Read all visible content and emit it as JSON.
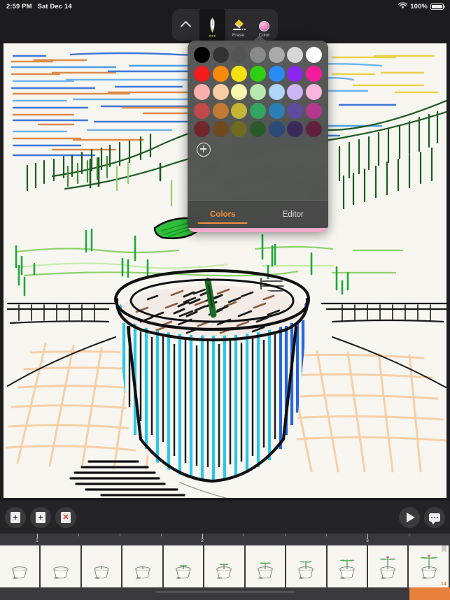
{
  "status_bar": {
    "time": "2:59 PM",
    "date": "Sat Dec 14",
    "battery_percent": "100%",
    "wifi_icon": "wifi-icon",
    "battery_icon": "battery-full-icon"
  },
  "toolbar": {
    "collapse_icon": "chevron-up-icon",
    "tools": [
      {
        "name": "pen",
        "label": "",
        "icon": "pen-nib-icon",
        "selected": true,
        "dots": "•••"
      },
      {
        "name": "erase",
        "label": "Erase",
        "icon": "eraser-icon",
        "selected": false
      },
      {
        "name": "color",
        "label": "Color",
        "icon": "color-swatch-icon",
        "selected": false
      }
    ]
  },
  "color_popup": {
    "current_color": "#f5a9c8",
    "add_color_label": "add-custom-color",
    "tabs": [
      {
        "label": "Colors",
        "active": true
      },
      {
        "label": "Editor",
        "active": false
      }
    ],
    "accent": "#ef8d3c",
    "swatch_rows": [
      [
        "#000000",
        "#333333",
        "#545454",
        "#8a8a8a",
        "#ababab",
        "#d6d6d6",
        "#ffffff"
      ],
      [
        "#f41c1c",
        "#f88a0a",
        "#f5e012",
        "#2fce12",
        "#2b8bf5",
        "#8a24f0",
        "#f51c9b"
      ],
      [
        "#f9b0ae",
        "#f9cda2",
        "#f7f5ae",
        "#b5e9ad",
        "#aed6f7",
        "#cfb4f7",
        "#f9b6dc"
      ],
      [
        "#c0494a",
        "#c07a33",
        "#c4b535",
        "#35a563",
        "#2c7fb4",
        "#5c4b9e",
        "#b5388f"
      ],
      [
        "#70272c",
        "#70491f",
        "#6e6a1f",
        "#2b5a2b",
        "#2a4a78",
        "#3a2a5c",
        "#62203e"
      ]
    ]
  },
  "bottom_bar": {
    "buttons": [
      {
        "name": "add-frame",
        "icon": "page-plus-icon",
        "glyph": "+"
      },
      {
        "name": "duplicate-frame",
        "icon": "pages-plus-icon",
        "glyph": "+"
      },
      {
        "name": "delete-frame",
        "icon": "page-x-icon",
        "glyph": "✕"
      },
      {
        "name": "play",
        "icon": "play-triangle-icon"
      },
      {
        "name": "more-options",
        "icon": "speech-bubble-dots-icon"
      }
    ]
  },
  "timeline": {
    "ruler_labels": [
      "1",
      "2",
      "3"
    ],
    "frames": [
      {
        "index": 1,
        "stage": 0
      },
      {
        "index": 2,
        "stage": 0
      },
      {
        "index": 3,
        "stage": 1
      },
      {
        "index": 4,
        "stage": 1
      },
      {
        "index": 5,
        "stage": 2
      },
      {
        "index": 6,
        "stage": 3
      },
      {
        "index": 7,
        "stage": 4
      },
      {
        "index": 8,
        "stage": 5
      },
      {
        "index": 9,
        "stage": 6
      },
      {
        "index": 10,
        "stage": 7
      },
      {
        "index": 11,
        "stage": 8
      }
    ],
    "selected_frame_number": "14",
    "selected_index": 11,
    "bookmark_on_selected": true,
    "selection_color": "#e8813c"
  },
  "artwork": {
    "description": "hand-drawn scene: striped sky, green hills, cyan plant pot with soil and sprout, tiled floor",
    "paper_color": "#f7f6f1",
    "pot_color": "#2ec6e8",
    "soil_color": "#8c5a3c",
    "hill_color": "#1e5c24",
    "tile_color": "#f8cfa6"
  }
}
